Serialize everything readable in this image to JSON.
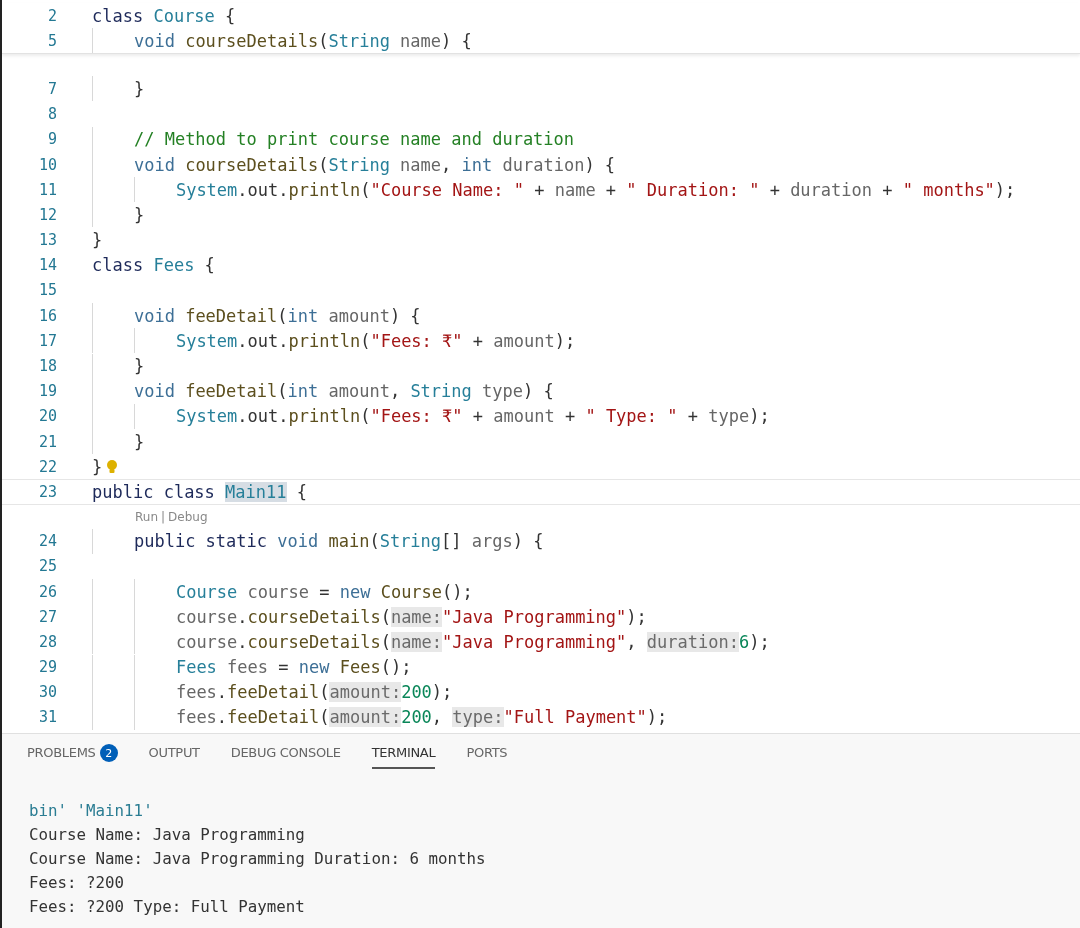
{
  "editor": {
    "sticky_lines": [
      {
        "number": "2",
        "tokens": [
          {
            "text": "class",
            "kind": "kw"
          },
          {
            "text": " Course",
            "kind": "type"
          },
          {
            "text": " {",
            "kind": "p"
          }
        ]
      },
      {
        "number": "5",
        "tokens": [
          {
            "text": "    void",
            "kind": "prim"
          },
          {
            "text": " courseDetails",
            "kind": "fn"
          },
          {
            "text": "(",
            "kind": "p"
          },
          {
            "text": "String",
            "kind": "type"
          },
          {
            "text": " name",
            "kind": "var"
          },
          {
            "text": ") {",
            "kind": "p"
          }
        ]
      }
    ],
    "lines": [
      {
        "number": "7",
        "tokens": [
          {
            "text": "    }",
            "kind": "p"
          }
        ]
      },
      {
        "number": "8"
      },
      {
        "number": "9",
        "tokens": [
          {
            "text": "    // Method to print course name and duration",
            "kind": "com"
          }
        ]
      },
      {
        "number": "10",
        "tokens": [
          {
            "text": "    void",
            "kind": "prim"
          },
          {
            "text": " courseDetails",
            "kind": "fn"
          },
          {
            "text": "(",
            "kind": "p"
          },
          {
            "text": "String",
            "kind": "type"
          },
          {
            "text": " name",
            "kind": "var"
          },
          {
            "text": ",",
            "kind": "p"
          },
          {
            "text": " int",
            "kind": "prim"
          },
          {
            "text": " duration",
            "kind": "var"
          },
          {
            "text": ") {",
            "kind": "p"
          }
        ]
      },
      {
        "number": "11",
        "tokens": [
          {
            "text": "        System",
            "kind": "type"
          },
          {
            "text": ".out.",
            "kind": "p"
          },
          {
            "text": "println",
            "kind": "fn"
          },
          {
            "text": "(",
            "kind": "p"
          },
          {
            "text": "\"Course Name: \"",
            "kind": "str"
          },
          {
            "text": " +",
            "kind": "p"
          },
          {
            "text": " name",
            "kind": "var"
          },
          {
            "text": " +",
            "kind": "p"
          },
          {
            "text": " \" Duration: \"",
            "kind": "str"
          },
          {
            "text": " +",
            "kind": "p"
          },
          {
            "text": " duration",
            "kind": "var"
          },
          {
            "text": " +",
            "kind": "p"
          },
          {
            "text": " \" months\"",
            "kind": "str"
          },
          {
            "text": ");",
            "kind": "p"
          }
        ]
      },
      {
        "number": "12",
        "tokens": [
          {
            "text": "    }",
            "kind": "p"
          }
        ]
      },
      {
        "number": "13",
        "tokens": [
          {
            "text": "}",
            "kind": "p"
          }
        ]
      },
      {
        "number": "14",
        "tokens": [
          {
            "text": "class",
            "kind": "kw"
          },
          {
            "text": " Fees",
            "kind": "type"
          },
          {
            "text": " {",
            "kind": "p"
          }
        ]
      },
      {
        "number": "15"
      },
      {
        "number": "16",
        "tokens": [
          {
            "text": "    void",
            "kind": "prim"
          },
          {
            "text": " feeDetail",
            "kind": "fn"
          },
          {
            "text": "(",
            "kind": "p"
          },
          {
            "text": "int",
            "kind": "prim"
          },
          {
            "text": " amount",
            "kind": "var"
          },
          {
            "text": ") {",
            "kind": "p"
          }
        ]
      },
      {
        "number": "17",
        "tokens": [
          {
            "text": "        System",
            "kind": "type"
          },
          {
            "text": ".out.",
            "kind": "p"
          },
          {
            "text": "println",
            "kind": "fn"
          },
          {
            "text": "(",
            "kind": "p"
          },
          {
            "text": "\"Fees: ₹\"",
            "kind": "str"
          },
          {
            "text": " +",
            "kind": "p"
          },
          {
            "text": " amount",
            "kind": "var"
          },
          {
            "text": ");",
            "kind": "p"
          }
        ]
      },
      {
        "number": "18",
        "tokens": [
          {
            "text": "    }",
            "kind": "p"
          }
        ]
      },
      {
        "number": "19",
        "tokens": [
          {
            "text": "    void",
            "kind": "prim"
          },
          {
            "text": " feeDetail",
            "kind": "fn"
          },
          {
            "text": "(",
            "kind": "p"
          },
          {
            "text": "int",
            "kind": "prim"
          },
          {
            "text": " amount",
            "kind": "var"
          },
          {
            "text": ",",
            "kind": "p"
          },
          {
            "text": " String",
            "kind": "type"
          },
          {
            "text": " type",
            "kind": "var"
          },
          {
            "text": ") {",
            "kind": "p"
          }
        ]
      },
      {
        "number": "20",
        "tokens": [
          {
            "text": "        System",
            "kind": "type"
          },
          {
            "text": ".out.",
            "kind": "p"
          },
          {
            "text": "println",
            "kind": "fn"
          },
          {
            "text": "(",
            "kind": "p"
          },
          {
            "text": "\"Fees: ₹\"",
            "kind": "str"
          },
          {
            "text": " +",
            "kind": "p"
          },
          {
            "text": " amount",
            "kind": "var"
          },
          {
            "text": " +",
            "kind": "p"
          },
          {
            "text": " \" Type: \"",
            "kind": "str"
          },
          {
            "text": " +",
            "kind": "p"
          },
          {
            "text": " type",
            "kind": "var"
          },
          {
            "text": ");",
            "kind": "p"
          }
        ]
      },
      {
        "number": "21",
        "tokens": [
          {
            "text": "    }",
            "kind": "p"
          }
        ]
      },
      {
        "number": "22",
        "lightbulb": true,
        "tokens": [
          {
            "text": "}",
            "kind": "p"
          }
        ]
      },
      {
        "number": "23",
        "current": true,
        "tokens": [
          {
            "text": "public",
            "kind": "kw"
          },
          {
            "text": " class ",
            "kind": "kw"
          },
          {
            "text": "Main11",
            "kind": "hl"
          },
          {
            "text": " {",
            "kind": "p"
          }
        ]
      },
      {
        "kind": "codelens",
        "links": [
          "Run",
          "Debug"
        ],
        "separator": "|"
      },
      {
        "number": "24",
        "tokens": [
          {
            "text": "    public",
            "kind": "kw"
          },
          {
            "text": " static",
            "kind": "kw"
          },
          {
            "text": " void",
            "kind": "prim"
          },
          {
            "text": " main",
            "kind": "fn"
          },
          {
            "text": "(",
            "kind": "p"
          },
          {
            "text": "String",
            "kind": "type"
          },
          {
            "text": "[]",
            "kind": "p"
          },
          {
            "text": " args",
            "kind": "var"
          },
          {
            "text": ") {",
            "kind": "p"
          }
        ]
      },
      {
        "number": "25"
      },
      {
        "number": "26",
        "tokens": [
          {
            "text": "        Course",
            "kind": "type"
          },
          {
            "text": " course",
            "kind": "var"
          },
          {
            "text": " =",
            "kind": "p"
          },
          {
            "text": " new",
            "kind": "prim"
          },
          {
            "text": " Course",
            "kind": "fn"
          },
          {
            "text": "();",
            "kind": "p"
          }
        ]
      },
      {
        "number": "27",
        "tokens": [
          {
            "text": "        course",
            "kind": "var"
          },
          {
            "text": ".",
            "kind": "p"
          },
          {
            "text": "courseDetails",
            "kind": "fn"
          },
          {
            "text": "(",
            "kind": "p"
          },
          {
            "text": "name:",
            "kind": "hint"
          },
          {
            "text": "\"Java Programming\"",
            "kind": "str"
          },
          {
            "text": ");",
            "kind": "p"
          }
        ]
      },
      {
        "number": "28",
        "tokens": [
          {
            "text": "        course",
            "kind": "var"
          },
          {
            "text": ".",
            "kind": "p"
          },
          {
            "text": "courseDetails",
            "kind": "fn"
          },
          {
            "text": "(",
            "kind": "p"
          },
          {
            "text": "name:",
            "kind": "hint"
          },
          {
            "text": "\"Java Programming\"",
            "kind": "str"
          },
          {
            "text": ", ",
            "kind": "p"
          },
          {
            "text": "duration:",
            "kind": "hint"
          },
          {
            "text": "6",
            "kind": "num"
          },
          {
            "text": ");",
            "kind": "p"
          }
        ]
      },
      {
        "number": "29",
        "tokens": [
          {
            "text": "        Fees",
            "kind": "type"
          },
          {
            "text": " fees",
            "kind": "var"
          },
          {
            "text": " =",
            "kind": "p"
          },
          {
            "text": " new",
            "kind": "prim"
          },
          {
            "text": " Fees",
            "kind": "fn"
          },
          {
            "text": "();",
            "kind": "p"
          }
        ]
      },
      {
        "number": "30",
        "tokens": [
          {
            "text": "        fees",
            "kind": "var"
          },
          {
            "text": ".",
            "kind": "p"
          },
          {
            "text": "feeDetail",
            "kind": "fn"
          },
          {
            "text": "(",
            "kind": "p"
          },
          {
            "text": "amount:",
            "kind": "hint"
          },
          {
            "text": "200",
            "kind": "num"
          },
          {
            "text": ");",
            "kind": "p"
          }
        ]
      },
      {
        "number": "31",
        "tokens": [
          {
            "text": "        fees",
            "kind": "var"
          },
          {
            "text": ".",
            "kind": "p"
          },
          {
            "text": "feeDetail",
            "kind": "fn"
          },
          {
            "text": "(",
            "kind": "p"
          },
          {
            "text": "amount:",
            "kind": "hint"
          },
          {
            "text": "200",
            "kind": "num"
          },
          {
            "text": ", ",
            "kind": "p"
          },
          {
            "text": "type:",
            "kind": "hint"
          },
          {
            "text": "\"Full Payment\"",
            "kind": "str"
          },
          {
            "text": ");",
            "kind": "p"
          }
        ]
      }
    ]
  },
  "panel": {
    "tabs": [
      {
        "label": "PROBLEMS",
        "selected": false,
        "badge": "2"
      },
      {
        "label": "OUTPUT",
        "selected": false
      },
      {
        "label": "DEBUG CONSOLE",
        "selected": false
      },
      {
        "label": "TERMINAL",
        "selected": true
      },
      {
        "label": "PORTS",
        "selected": false
      }
    ],
    "terminal": [
      {
        "text": "bin' 'Main11'",
        "kind": "command"
      },
      {
        "text": "Course Name: Java Programming",
        "kind": "output"
      },
      {
        "text": "Course Name: Java Programming Duration: 6 months",
        "kind": "output"
      },
      {
        "text": "Fees: ?200",
        "kind": "output"
      },
      {
        "text": "Fees: ?200 Type: Full Payment",
        "kind": "output"
      }
    ]
  }
}
